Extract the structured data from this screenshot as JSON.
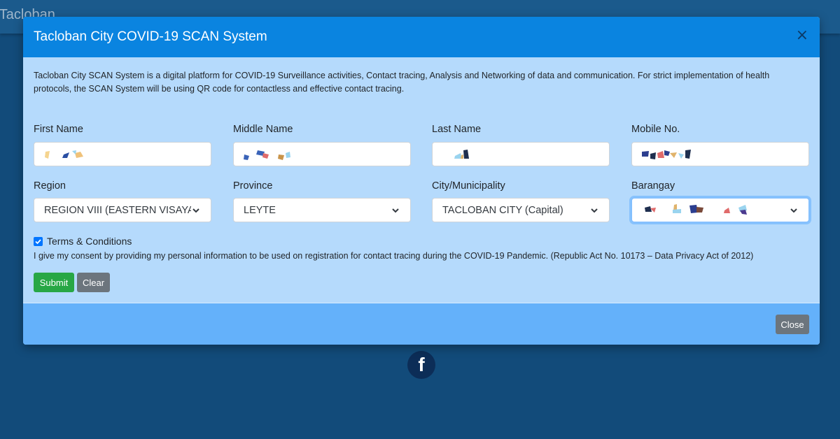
{
  "background": {
    "page_title_fragment": "f Tacloban",
    "facebook_icon_glyph": "f"
  },
  "modal": {
    "title": "Tacloban City COVID-19 SCAN System",
    "close_symbol": "×",
    "intro": "Tacloban City SCAN System is a digital platform for COVID-19 Surveillance activities, Contact tracing, Analysis and Networking of data and communication. For strict implementation of health protocols, the SCAN System will be using QR code for contactless and effective contact tracing.",
    "fields": {
      "first_name": {
        "label": "First Name"
      },
      "middle_name": {
        "label": "Middle Name"
      },
      "last_name": {
        "label": "Last Name"
      },
      "mobile": {
        "label": "Mobile No."
      },
      "region": {
        "label": "Region",
        "value": "REGION VIII (EASTERN VISAYAS)"
      },
      "province": {
        "label": "Province",
        "value": "LEYTE"
      },
      "city": {
        "label": "City/Municipality",
        "value": "TACLOBAN CITY (Capital)"
      },
      "barangay": {
        "label": "Barangay"
      }
    },
    "terms": {
      "label": "Terms & Conditions",
      "checked": true,
      "consent": "I give my consent by providing my personal information to be used on registration for contact tracing during the COVID-19 Pandemic. (Republic Act No. 10173 – Data Privacy Act of 2012)"
    },
    "buttons": {
      "submit": "Submit",
      "clear": "Clear",
      "close": "Close"
    }
  },
  "colors": {
    "page_background": "#124b7a",
    "modal_header": "#0a84e0",
    "modal_body": "#b5dafc",
    "modal_footer": "#64b1fa",
    "submit": "#28a745",
    "secondary": "#6c757d"
  }
}
